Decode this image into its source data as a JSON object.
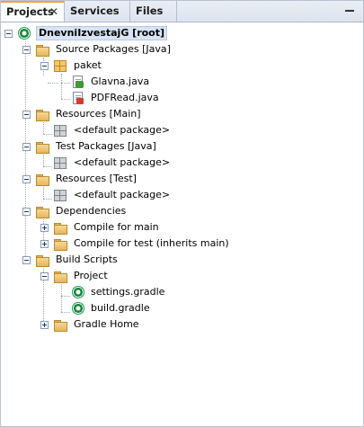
{
  "tabs": [
    {
      "label": "Projects",
      "close": "✕"
    },
    {
      "label": "Services"
    },
    {
      "label": "Files"
    }
  ],
  "tree": {
    "root": "DnevniIzvestajG [root]",
    "source_packages": "Source Packages [Java]",
    "paket": "paket",
    "glavna": "Glavna.java",
    "pdfread": "PDFRead.java",
    "resources_main": "Resources [Main]",
    "default_pkg_1": "<default package>",
    "test_packages": "Test Packages [Java]",
    "default_pkg_2": "<default package>",
    "resources_test": "Resources [Test]",
    "default_pkg_3": "<default package>",
    "dependencies": "Dependencies",
    "compile_main": "Compile for main",
    "compile_test": "Compile for test (inherits main)",
    "build_scripts": "Build Scripts",
    "project": "Project",
    "settings_gradle": "settings.gradle",
    "build_gradle": "build.gradle",
    "gradle_home": "Gradle Home"
  },
  "colors": {
    "accent": "#f1a53a",
    "selection": "#d8e4f4"
  }
}
